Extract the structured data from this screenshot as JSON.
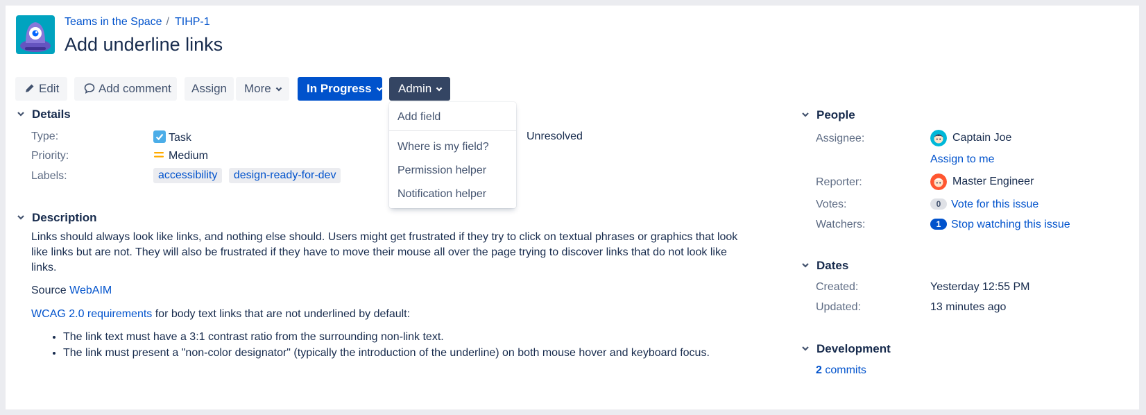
{
  "breadcrumb": {
    "project": "Teams in the Space",
    "separator": "/",
    "issue_key": "TIHP-1"
  },
  "issue": {
    "title": "Add underline links"
  },
  "toolbar": {
    "edit_label": "Edit",
    "comment_label": "Add comment",
    "assign_label": "Assign",
    "more_label": "More",
    "status_label": "In Progress",
    "admin_label": "Admin"
  },
  "admin_menu": {
    "items": [
      "Add field",
      "Where is my field?",
      "Permission helper",
      "Notification helper"
    ]
  },
  "details": {
    "heading": "Details",
    "type_label": "Type:",
    "type_value": "Task",
    "priority_label": "Priority:",
    "priority_value": "Medium",
    "labels_label": "Labels:",
    "labels": [
      "accessibility",
      "design-ready-for-dev"
    ],
    "resolution_value": "Unresolved"
  },
  "description": {
    "heading": "Description",
    "paragraph": "Links should always look like links, and nothing else should. Users might get frustrated if they try to click on textual phrases or graphics that look like links but are not. They will also be frustrated if they have to move their mouse all over the page trying to discover links that do not look like links.",
    "source_prefix": "Source",
    "source_link": "WebAIM",
    "wcag_link": "WCAG 2.0 requirements",
    "wcag_suffix": "for body text links that are not underlined by default:",
    "bullets": [
      "The link text must have a 3:1 contrast ratio from the surrounding non-link text.",
      "The link must present a \"non-color designator\" (typically the introduction of the underline) on both mouse hover and keyboard focus."
    ]
  },
  "people": {
    "heading": "People",
    "assignee_label": "Assignee:",
    "assignee_name": "Captain Joe",
    "assign_to_me": "Assign to me",
    "reporter_label": "Reporter:",
    "reporter_name": "Master Engineer",
    "votes_label": "Votes:",
    "votes_count": "0",
    "vote_link": "Vote for this issue",
    "watchers_label": "Watchers:",
    "watchers_count": "1",
    "watch_link": "Stop watching this issue"
  },
  "dates": {
    "heading": "Dates",
    "created_label": "Created:",
    "created_value": "Yesterday 12:55 PM",
    "updated_label": "Updated:",
    "updated_value": "13 minutes ago"
  },
  "development": {
    "heading": "Development",
    "commits_count": "2",
    "commits_label": "commits"
  },
  "colors": {
    "primary": "#0052cc",
    "admin": "#344563",
    "text": "#172b4d",
    "muted": "#5e6c84",
    "priority_medium": "#ffab00",
    "task_icon": "#4bade8"
  }
}
